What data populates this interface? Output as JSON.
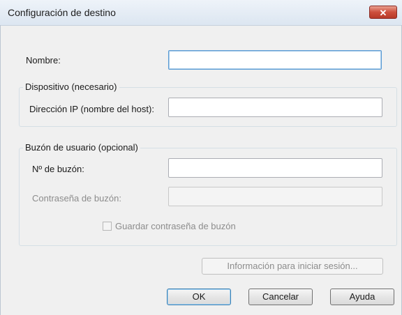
{
  "window": {
    "title": "Configuración de destino",
    "close_symbol": "✕"
  },
  "fields": {
    "nombre_label": "Nombre:",
    "nombre_value": ""
  },
  "dispositivo": {
    "legend": "Dispositivo (necesario)",
    "ip_label": "Dirección IP (nombre del host):",
    "ip_value": ""
  },
  "buzon": {
    "legend": "Buzón de usuario (opcional)",
    "numero_label": "Nº de buzón:",
    "numero_value": "",
    "password_label": "Contraseña de buzón:",
    "password_value": "",
    "save_password_label": "Guardar contraseña de buzón",
    "save_password_checked": false
  },
  "buttons": {
    "login_info": "Información para iniciar sesión...",
    "ok": "OK",
    "cancel": "Cancelar",
    "help": "Ayuda"
  },
  "colors": {
    "close_button": "#cd4f3c",
    "default_button_border": "#3c7fb1",
    "focus_border": "#5a9bd5"
  }
}
